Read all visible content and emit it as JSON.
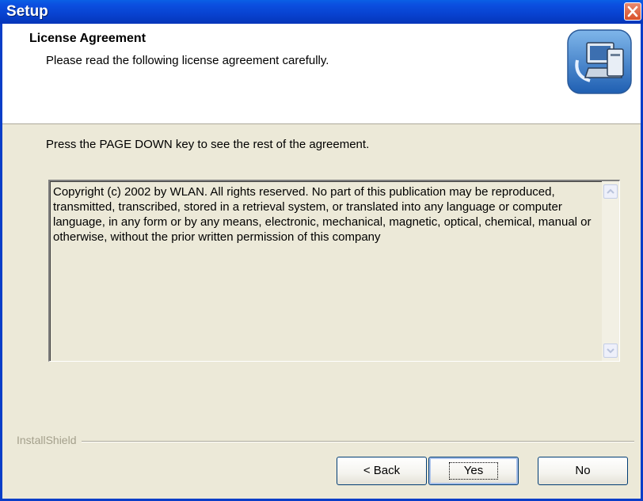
{
  "window": {
    "title": "Setup",
    "titlebar_color": "#0842d0"
  },
  "header": {
    "title": "License Agreement",
    "subtitle": "Please read the following license agreement carefully.",
    "icon": "installer-computer-icon"
  },
  "instruction": "Press the PAGE DOWN key to see the rest of the agreement.",
  "license": {
    "text": "Copyright (c) 2002 by WLAN. All rights reserved. No part of this publication may be reproduced, transmitted, transcribed, stored in a retrieval system, or translated into any language or computer language, in any form or by any means, electronic, mechanical, magnetic, optical, chemical, manual or otherwise, without the prior written permission of this company"
  },
  "brand": "InstallShield",
  "buttons": {
    "back": "< Back",
    "yes": "Yes",
    "no": "No"
  }
}
